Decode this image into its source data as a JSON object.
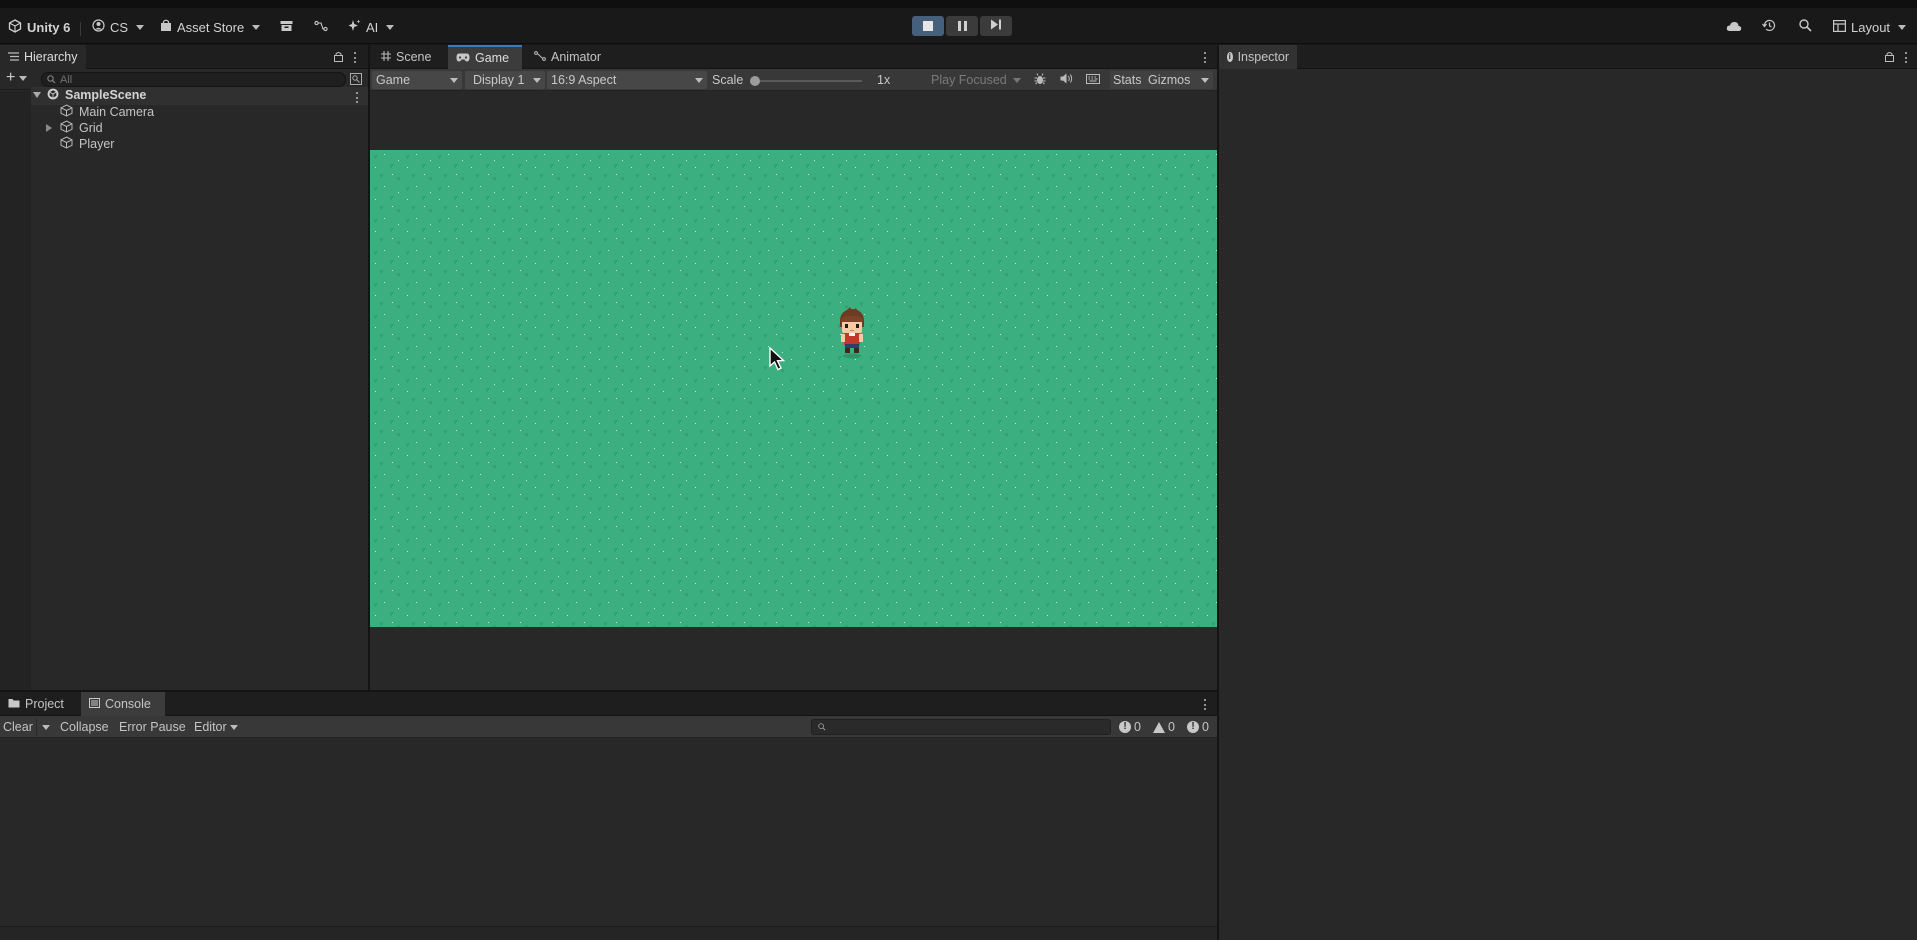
{
  "toolbar": {
    "unity_label": "Unity 6",
    "account_label": "CS",
    "asset_store_label": "Asset Store",
    "ai_label": "AI",
    "layout_label": "Layout",
    "icons": [
      "unity-logo-icon",
      "account-icon",
      "bag-icon",
      "package-icon",
      "version-control-icon",
      "sparkle-icon",
      "play-stop-icon",
      "pause-icon",
      "step-icon",
      "cloud-icon",
      "history-icon",
      "search-icon",
      "layout-icon"
    ]
  },
  "hierarchy": {
    "tab_label": "Hierarchy",
    "search_placeholder": "All",
    "scene": "SampleScene",
    "items": [
      "Main Camera",
      "Grid",
      "Player"
    ]
  },
  "center": {
    "tabs": [
      "Scene",
      "Game",
      "Animator"
    ],
    "active_tab": "Game",
    "game_dropdown": "Game",
    "display_dropdown": "Display 1",
    "aspect_dropdown": "16:9 Aspect",
    "scale_label": "Scale",
    "scale_value": "1x",
    "play_focused_dropdown": "Play Focused",
    "stats_label": "Stats",
    "gizmos_label": "Gizmos",
    "game_bg_color": "#3caf80"
  },
  "inspector": {
    "tab_label": "Inspector"
  },
  "bottom": {
    "tabs": [
      "Project",
      "Console"
    ],
    "active_tab": "Console",
    "clear_label": "Clear",
    "collapse_label": "Collapse",
    "error_pause_label": "Error Pause",
    "editor_label": "Editor",
    "counts": {
      "info": "0",
      "warnings": "0",
      "errors": "0"
    }
  },
  "colors": {
    "accent": "#3a79bb",
    "play_active": "#46607c",
    "grass": "#3caf80"
  }
}
